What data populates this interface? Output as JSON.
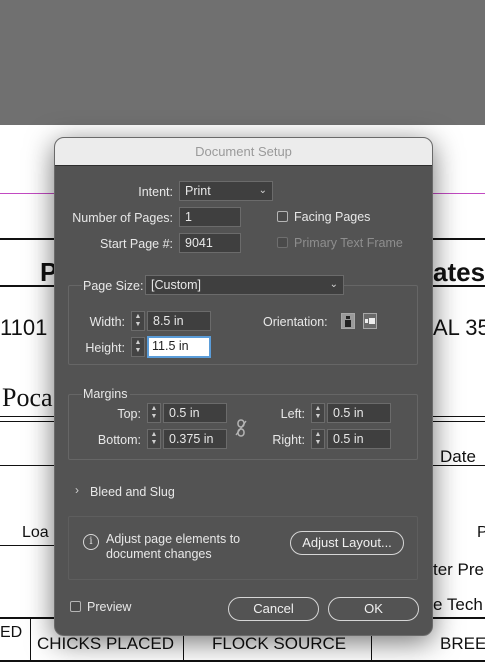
{
  "background": {
    "texts": [
      "P",
      "ates",
      "1101",
      "AL 35",
      "Poca",
      "Date",
      "Loa",
      "P",
      "ter Pre",
      "e Tech",
      "ED",
      "CHICKS PLACED",
      "FLOCK SOURCE",
      "BREE"
    ]
  },
  "dialog": {
    "title": "Document Setup",
    "intent": {
      "label": "Intent:",
      "value": "Print"
    },
    "num_pages": {
      "label": "Number of Pages:",
      "value": "1"
    },
    "start_page": {
      "label": "Start Page #:",
      "value": "9041"
    },
    "facing_pages": {
      "label": "Facing Pages",
      "checked": false
    },
    "primary_text_frame": {
      "label": "Primary Text Frame",
      "checked": false,
      "enabled": false
    },
    "page_size": {
      "label": "Page Size:",
      "value": "[Custom]"
    },
    "width": {
      "label": "Width:",
      "value": "8.5 in"
    },
    "height": {
      "label": "Height:",
      "value": "11.5 in"
    },
    "orientation": {
      "label": "Orientation:",
      "selected": "portrait"
    },
    "margins": {
      "title": "Margins",
      "top": {
        "label": "Top:",
        "value": "0.5 in"
      },
      "bottom": {
        "label": "Bottom:",
        "value": "0.375 in"
      },
      "left": {
        "label": "Left:",
        "value": "0.5 in"
      },
      "right": {
        "label": "Right:",
        "value": "0.5 in"
      }
    },
    "bleed_slug": {
      "label": "Bleed and Slug"
    },
    "adjust": {
      "text_line1": "Adjust page elements to",
      "text_line2": "document changes",
      "button": "Adjust Layout..."
    },
    "preview": {
      "label": "Preview",
      "checked": false
    },
    "cancel": "Cancel",
    "ok": "OK"
  }
}
